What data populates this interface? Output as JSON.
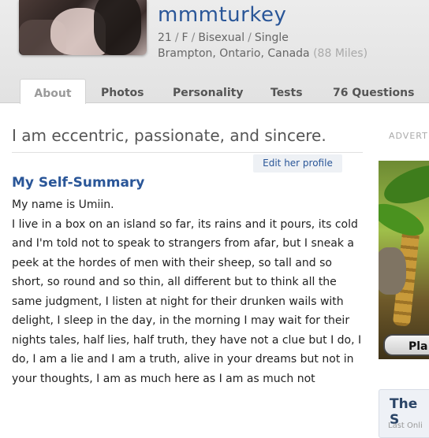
{
  "profile": {
    "username": "mmmturkey",
    "age": "21",
    "gender": "F",
    "orientation": "Bisexual",
    "status": "Single",
    "location": "Brampton, Ontario, Canada",
    "distance": "(88 Miles)",
    "separator": "/"
  },
  "tabs": [
    {
      "label": "About"
    },
    {
      "label": "Photos"
    },
    {
      "label": "Personality"
    },
    {
      "label": "Tests"
    },
    {
      "label": "76 Questions"
    }
  ],
  "main": {
    "tagline": "I am eccentric, passionate, and sincere.",
    "edit_label": "Edit her profile",
    "section_title": "My Self-Summary",
    "summary_line1": "My name is Umiin.",
    "summary_body": "I live in a box on an island so far, its rains and it pours, its cold and I'm told not to speak to strangers from afar, but I sneak a peek at the hordes of men with their sheep, so tall and so short, so round and so thin, all different but to think all the same judgment, I listen at night for their drunken wails with delight, I sleep in the day, in the morning I may wait for their nights tales, half lies, half truth, they have not a clue but I do, I do, I am a lie and I am a truth, alive in your dreams but not in your thoughts, I am as much here as I am as much not"
  },
  "sidebar": {
    "ad_label": "ADVERT",
    "ad_button": "Pla",
    "box_title": "The S",
    "box_sub": "Last Onli"
  },
  "colors": {
    "accent": "#2a5698",
    "header_bg": "#e6e6e6"
  }
}
